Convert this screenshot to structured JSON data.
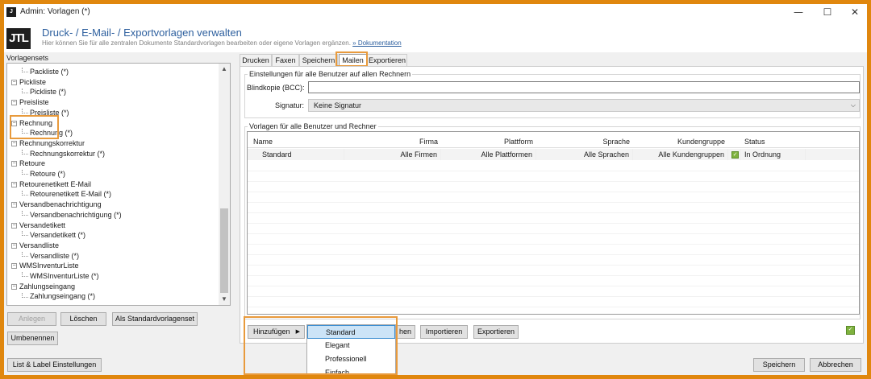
{
  "window": {
    "title": "Admin: Vorlagen (*)",
    "minimize": "—",
    "maximize": "☐",
    "close": "✕"
  },
  "header": {
    "logo": "JTL",
    "title": "Druck- / E-Mail- / Exportvorlagen verwalten",
    "subtitle": "Hier können Sie für alle zentralen Dokumente Standardvorlagen bearbeiten oder eigene Vorlagen ergänzen.",
    "doc_link": "» Dokumentation"
  },
  "sidebar": {
    "label": "Vorlagensets",
    "tree": [
      {
        "label": "Packliste (*)",
        "child": true
      },
      {
        "label": "Pickliste",
        "child": false
      },
      {
        "label": "Pickliste (*)",
        "child": true
      },
      {
        "label": "Preisliste",
        "child": false
      },
      {
        "label": "Preisliste (*)",
        "child": true
      },
      {
        "label": "Rechnung",
        "child": false
      },
      {
        "label": "Rechnung (*)",
        "child": true
      },
      {
        "label": "Rechnungskorrektur",
        "child": false
      },
      {
        "label": "Rechnungskorrektur (*)",
        "child": true
      },
      {
        "label": "Retoure",
        "child": false
      },
      {
        "label": "Retoure (*)",
        "child": true
      },
      {
        "label": "Retourenetikett E-Mail",
        "child": false
      },
      {
        "label": "Retourenetikett E-Mail (*)",
        "child": true
      },
      {
        "label": "Versandbenachrichtigung",
        "child": false
      },
      {
        "label": "Versandbenachrichtigung (*)",
        "child": true
      },
      {
        "label": "Versandetikett",
        "child": false
      },
      {
        "label": "Versandetikett (*)",
        "child": true
      },
      {
        "label": "Versandliste",
        "child": false
      },
      {
        "label": "Versandliste (*)",
        "child": true
      },
      {
        "label": "WMSInventurListe",
        "child": false
      },
      {
        "label": "WMSInventurListe (*)",
        "child": true
      },
      {
        "label": "Zahlungseingang",
        "child": false
      },
      {
        "label": "Zahlungseingang (*)",
        "child": true
      }
    ],
    "buttons": {
      "anlegen": "Anlegen",
      "loeschen": "Löschen",
      "standard": "Als Standardvorlagenset",
      "umbenennen": "Umbenennen"
    }
  },
  "tabs": [
    "Drucken",
    "Faxen",
    "Speichern",
    "Mailen",
    "Exportieren"
  ],
  "active_tab": "Mailen",
  "settings": {
    "group_label": "Einstellungen für alle Benutzer auf allen Rechnern",
    "bcc_label": "Blindkopie (BCC):",
    "bcc_value": "",
    "signature_label": "Signatur:",
    "signature_value": "Keine Signatur"
  },
  "templates": {
    "group_label": "Vorlagen für alle Benutzer und Rechner",
    "columns": [
      "Name",
      "Firma",
      "Plattform",
      "Sprache",
      "Kundengruppe",
      "Status"
    ],
    "rows": [
      {
        "name": "Standard",
        "firma": "Alle Firmen",
        "plattform": "Alle Plattformen",
        "sprache": "Alle Sprachen",
        "kundengruppe": "Alle Kundengruppen",
        "status": "In Ordnung"
      }
    ]
  },
  "actions": {
    "hinzufuegen": "Hinzufügen",
    "bearbeiten_partial": "hen",
    "importieren": "Importieren",
    "exportieren": "Exportieren"
  },
  "dropdown_items": [
    "Standard",
    "Elegant",
    "Professionell",
    "Einfach"
  ],
  "footer": {
    "list_label": "List & Label Einstellungen",
    "speichern": "Speichern",
    "abbrechen": "Abbrechen"
  },
  "colors": {
    "accent": "#2d5f9e",
    "highlight": "#e89a3c",
    "status_ok": "#7fb23e"
  }
}
